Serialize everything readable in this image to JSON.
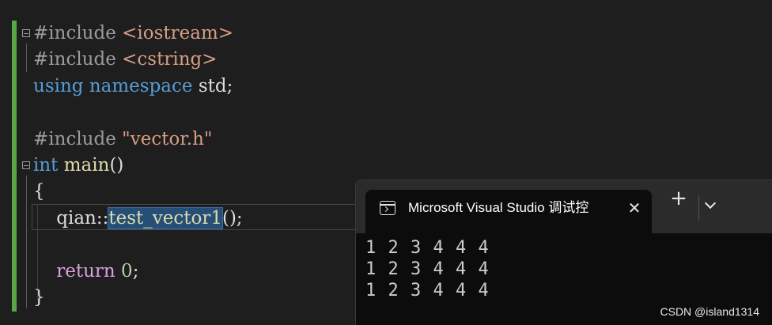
{
  "editor": {
    "lines": [
      {
        "tokens": [
          {
            "t": "#include ",
            "c": "pp"
          },
          {
            "t": "<iostream>",
            "c": "str"
          }
        ]
      },
      {
        "tokens": [
          {
            "t": "#include ",
            "c": "pp"
          },
          {
            "t": "<cstring>",
            "c": "str"
          }
        ]
      },
      {
        "tokens": [
          {
            "t": "using",
            "c": "kw"
          },
          {
            "t": " ",
            "c": "plain"
          },
          {
            "t": "namespace",
            "c": "kw"
          },
          {
            "t": " std;",
            "c": "plain"
          }
        ]
      },
      {
        "tokens": []
      },
      {
        "tokens": [
          {
            "t": "#include ",
            "c": "pp"
          },
          {
            "t": "\"vector.h\"",
            "c": "str"
          }
        ]
      },
      {
        "tokens": [
          {
            "t": "int",
            "c": "kw"
          },
          {
            "t": " ",
            "c": "plain"
          },
          {
            "t": "main",
            "c": "fn"
          },
          {
            "t": "()",
            "c": "plain"
          }
        ]
      },
      {
        "tokens": [
          {
            "t": "{",
            "c": "plain"
          }
        ]
      },
      {
        "tokens": [
          {
            "t": "    qian::",
            "c": "plain"
          },
          {
            "t": "test_vector1",
            "c": "hl"
          },
          {
            "t": "();",
            "c": "plain"
          }
        ]
      },
      {
        "tokens": []
      },
      {
        "tokens": [
          {
            "t": "    ",
            "c": "plain"
          },
          {
            "t": "return",
            "c": "ret"
          },
          {
            "t": " ",
            "c": "plain"
          },
          {
            "t": "0",
            "c": "num"
          },
          {
            "t": ";",
            "c": "plain"
          }
        ]
      },
      {
        "tokens": [
          {
            "t": "}",
            "c": "plain"
          }
        ]
      }
    ]
  },
  "terminal": {
    "tab_title": "Microsoft Visual Studio 调试控",
    "tab_close_glyph": "✕",
    "new_tab_glyph": "+",
    "output": [
      "1 2 3 4 4 4",
      "1 2 3 4 4 4",
      "1 2 3 4 4 4"
    ]
  },
  "watermark": "CSDN @island1314"
}
